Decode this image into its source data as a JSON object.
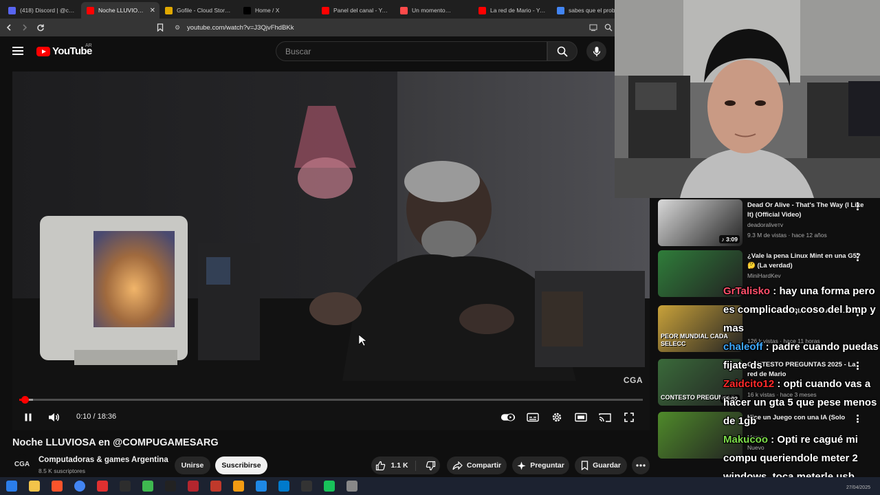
{
  "browser": {
    "tabs": [
      {
        "title": "(418) Discord | @chale",
        "color": "#5865f2",
        "icon": "discord-icon",
        "active": false
      },
      {
        "title": "Noche LLUVIOSA en",
        "color": "#ff0000",
        "icon": "youtube-icon",
        "active": true
      },
      {
        "title": "Gofile - Cloud Storage",
        "color": "#e0a800",
        "icon": "gofile-icon",
        "active": false
      },
      {
        "title": "Home / X",
        "color": "#000000",
        "icon": "x-icon",
        "active": false
      },
      {
        "title": "Panel del canal - YouTu",
        "color": "#ff0000",
        "icon": "youtube-studio-icon",
        "active": false
      },
      {
        "title": "Un momento…",
        "color": "#ff4a4a",
        "icon": "warning-icon",
        "active": false
      },
      {
        "title": "La red de Mario - YouT",
        "color": "#ff0000",
        "icon": "youtube-icon",
        "active": false
      },
      {
        "title": "sabes que el proble",
        "color": "#4285f4",
        "icon": "google-icon",
        "active": false
      }
    ],
    "url": "youtube.com/watch?v=J3QjvFhdBKk"
  },
  "youtube": {
    "logo_text": "YouTube",
    "country_code": "AR",
    "search_placeholder": "Buscar"
  },
  "player": {
    "watermark": "CGA",
    "time_display": "0:10 / 18:36",
    "progress_fraction": 0.009,
    "buffered_fraction": 0.022
  },
  "video": {
    "title": "Noche LLUVIOSA en @COMPUGAMESARG",
    "channel_avatar_text": "CGA",
    "channel_name": "Computadoras & games Argentina",
    "subscribers": "8.5 K suscriptores",
    "join_label": "Unirse",
    "subscribe_label": "Suscribirse",
    "likes": "1.1 K",
    "share_label": "Compartir",
    "ask_label": "Preguntar",
    "save_label": "Guardar"
  },
  "recommendations": [
    {
      "title": "Dead Or Alive - That's The Way (I Like It) (Official Video)",
      "channel": "deadoraliveтv",
      "meta": "9.3 M de vistas · hace 12 años",
      "duration": "♪ 3:09",
      "thumb_color": "#d9d9d9"
    },
    {
      "title": "¿Vale la pena Linux Mint en una G5? 🤔 (La verdad)",
      "channel": "MiniHardKev",
      "meta": "",
      "duration": "",
      "thumb_color": "#2f7d3a"
    },
    {
      "title": "AL PEOR MUNDIAL DE CADA ...",
      "channel": "",
      "meta": "126 k vistas · hace 11 horas",
      "duration": "",
      "thumb_color": "#c9a23a",
      "thumb_text": "PEOR MUNDIAL CADA SELECC"
    },
    {
      "title": "CONTESTO PREGUNTAS 2025 - La red de Mario",
      "channel": "",
      "meta": "16 k vistas · hace 3 meses",
      "duration": "55:02",
      "thumb_color": "#3a6a3a",
      "thumb_text": "CONTESTO PREGUNTAS"
    },
    {
      "title": "Hice un Juego con una IA (Solo",
      "channel": "Momex",
      "meta": "Nuevo",
      "duration": "",
      "thumb_color": "#4f8a2a"
    }
  ],
  "chat": [
    {
      "user": "GrTalisko",
      "user_color": "#ff4f6a",
      "message": "hay una forma pero es complicado, coso del bmp y mas"
    },
    {
      "user": "chaleoff",
      "user_color": "#3ea8ff",
      "message": "padre cuando puedas fijate ds"
    },
    {
      "user": "Zaidcito12",
      "user_color": "#ff2a2a",
      "message": "opti cuando vas a hacer un gta 5 que pese menos de 1gb"
    },
    {
      "user": "Makucoo",
      "user_color": "#7cdc4a",
      "message": "Opti re cagué mi compu queriendole meter 2 windows, toca meterle usb"
    }
  ],
  "taskbar": {
    "apps": [
      "windows-icon",
      "file-explorer-icon",
      "brave-icon",
      "chrome-icon",
      "record-icon",
      "obs-icon",
      "notepad-icon",
      "terminal-icon",
      "red-app-icon",
      "car-icon",
      "vlc-icon",
      "photos-icon",
      "vscode-icon",
      "7zip-icon",
      "green-app-icon",
      "tool-icon"
    ],
    "colors": [
      "#2b7de9",
      "#f3c44a",
      "#fb542b",
      "#4285f4",
      "#e03030",
      "#2d2d2d",
      "#3fb950",
      "#222222",
      "#b3262e",
      "#c0392b",
      "#f39c12",
      "#1e88e5",
      "#007acc",
      "#333333",
      "#18c25a",
      "#888888"
    ],
    "date": "27/04/2025"
  }
}
